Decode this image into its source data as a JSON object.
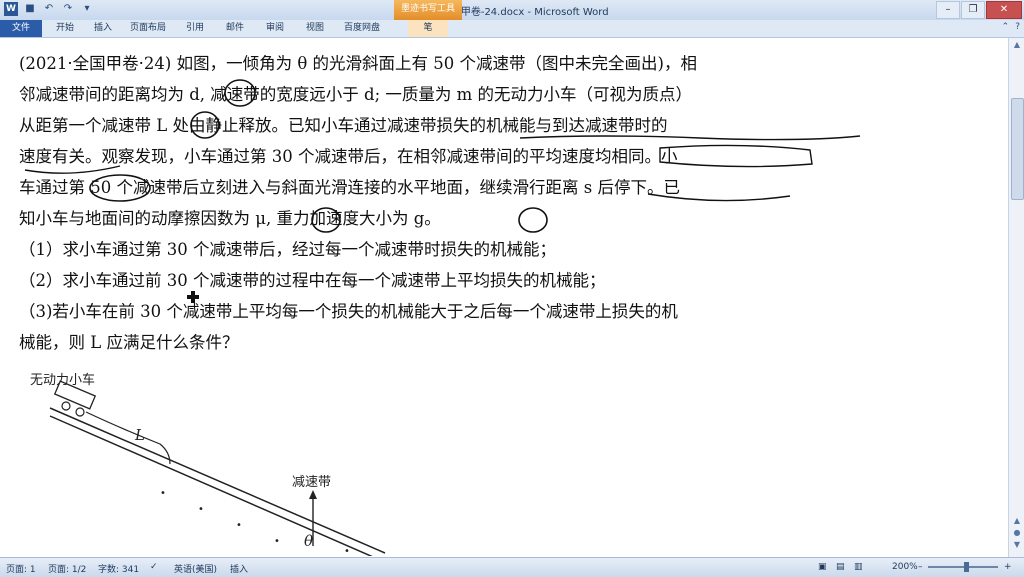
{
  "app": {
    "title": "2021全国甲卷-24.docx - Microsoft Word",
    "context_tab": "墨迹书写工具",
    "context_subtab": "笔",
    "logo": "W"
  },
  "tabs": [
    "文件",
    "开始",
    "插入",
    "页面布局",
    "引用",
    "邮件",
    "审阅",
    "视图",
    "百度网盘"
  ],
  "document": {
    "lines": [
      "(2021·全国甲卷·24)  如图，一倾角为 θ 的光滑斜面上有 50 个减速带（图中未完全画出)，相",
      "邻减速带间的距离均为 d, 减速带的宽度远小于 d; 一质量为 m 的无动力小车（可视为质点）",
      "从距第一个减速带 L 处由静止释放。已知小车通过减速带损失的机械能与到达减速带时的",
      "速度有关。观察发现，小车通过第 30 个减速带后，在相邻减速带间的平均速度均相同。小",
      "车通过第 50 个减速带后立刻进入与斜面光滑连接的水平地面，继续滑行距离 s 后停下。已",
      "知小车与地面间的动摩擦因数为 μ,  重力加速度大小为 g。",
      "（1）求小车通过第 30 个减速带后，经过每一个减速带时损失的机械能；",
      "（2）求小车通过前 30 个减速带的过程中在每一个减速带上平均损失的机械能；",
      "（3)若小车在前 30 个减速带上平均每一个损失的机械能大于之后每一个减速带上损失的机",
      "械能，则 L 应满足什么条件？"
    ],
    "figure": {
      "car_label": "无动力小车",
      "length_label": "L",
      "bump_label": "减速带",
      "angle_label": "θ"
    }
  },
  "status": {
    "page": "页面: 1",
    "pages": "页面: 1/2",
    "words": "字数: 341",
    "language": "英语(美国)",
    "mode": "插入",
    "zoom": "200%"
  }
}
